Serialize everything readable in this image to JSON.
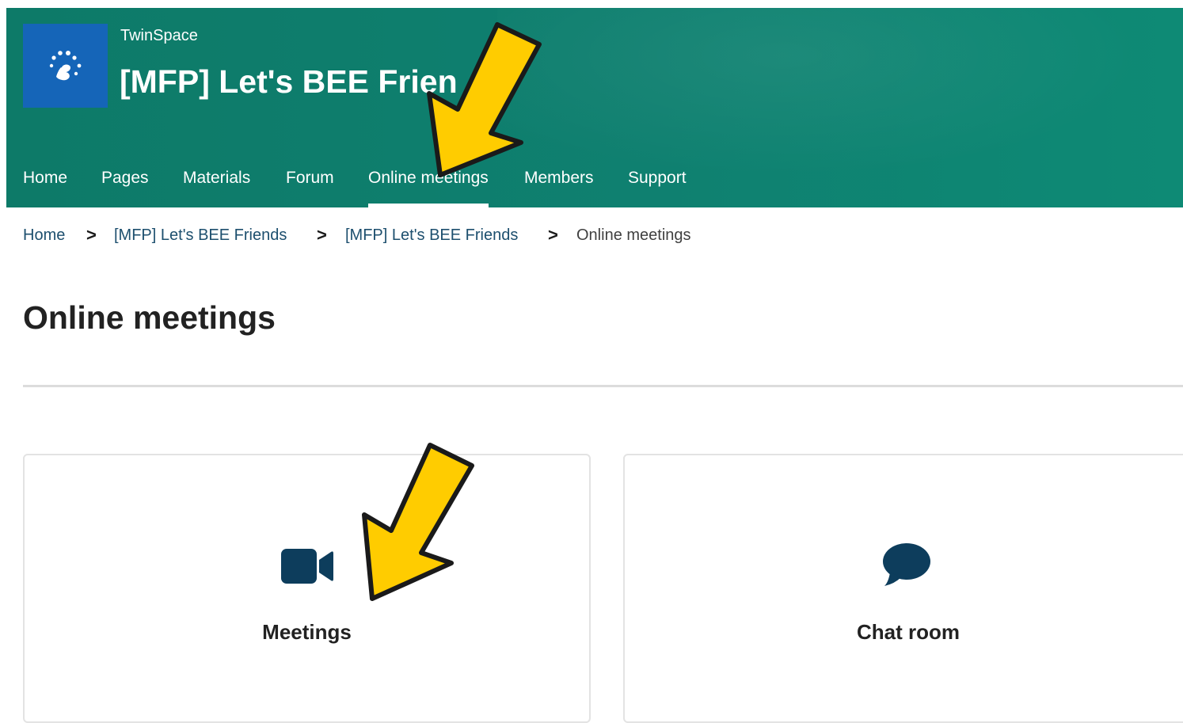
{
  "header": {
    "site_name": "TwinSpace",
    "project_title": "[MFP] Let's BEE Frien",
    "logo_icon": "twinning-stars-icon"
  },
  "nav": {
    "items": [
      {
        "label": "Home"
      },
      {
        "label": "Pages"
      },
      {
        "label": "Materials"
      },
      {
        "label": "Forum"
      },
      {
        "label": "Online meetings",
        "active": true
      },
      {
        "label": "Members"
      },
      {
        "label": "Support"
      }
    ]
  },
  "breadcrumb": {
    "items": [
      {
        "label": "Home"
      },
      {
        "label": "[MFP] Let's BEE Friends"
      },
      {
        "label": "[MFP] Let's BEE Friends"
      },
      {
        "label": "Online meetings"
      }
    ],
    "separator": ">"
  },
  "main": {
    "title": "Online meetings",
    "cards": [
      {
        "label": "Meetings",
        "icon": "video-camera-icon"
      },
      {
        "label": "Chat room",
        "icon": "speech-bubble-icon"
      }
    ]
  },
  "colors": {
    "header_bg": "#0f7d6c",
    "logo_bg": "#1565b8",
    "icon_color": "#0d3d5c",
    "arrow_fill": "#ffcc00",
    "arrow_outline": "#1a1a1a"
  }
}
